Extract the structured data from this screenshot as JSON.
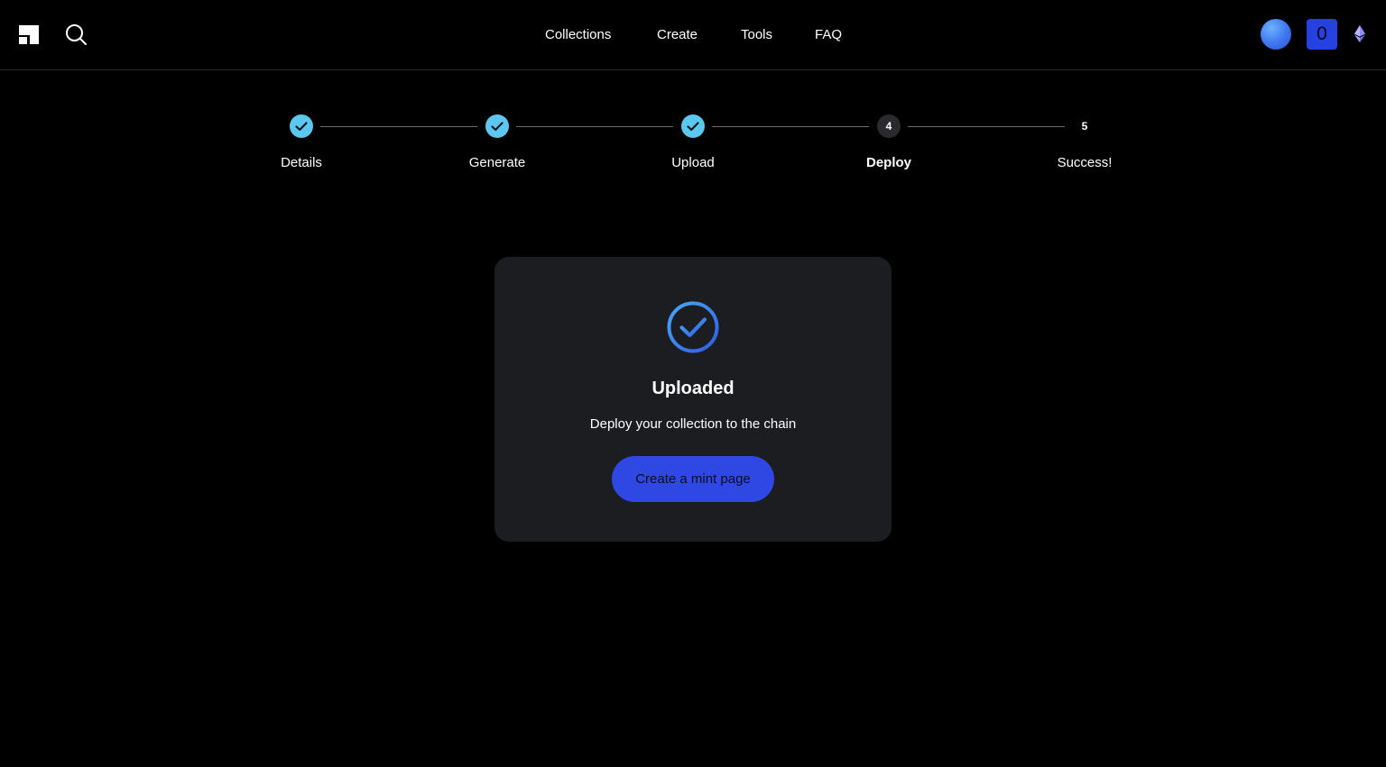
{
  "header": {
    "nav": [
      "Collections",
      "Create",
      "Tools",
      "FAQ"
    ],
    "badge_count": "0",
    "icons": {
      "logo": "logo-icon",
      "search": "search-icon",
      "avatar": "avatar",
      "network": "ethereum-icon"
    }
  },
  "stepper": {
    "steps": [
      {
        "label": "Details",
        "number": "1",
        "state": "done"
      },
      {
        "label": "Generate",
        "number": "2",
        "state": "done"
      },
      {
        "label": "Upload",
        "number": "3",
        "state": "done"
      },
      {
        "label": "Deploy",
        "number": "4",
        "state": "current"
      },
      {
        "label": "Success!",
        "number": "5",
        "state": "pending"
      }
    ]
  },
  "card": {
    "icon": "check-circle-icon",
    "title": "Uploaded",
    "subtitle": "Deploy your collection to the chain",
    "button_label": "Create a mint page"
  },
  "colors": {
    "background": "#000000",
    "card": "#1c1d21",
    "accent": "#2f48e4",
    "step_done": "#5cc8f0"
  }
}
